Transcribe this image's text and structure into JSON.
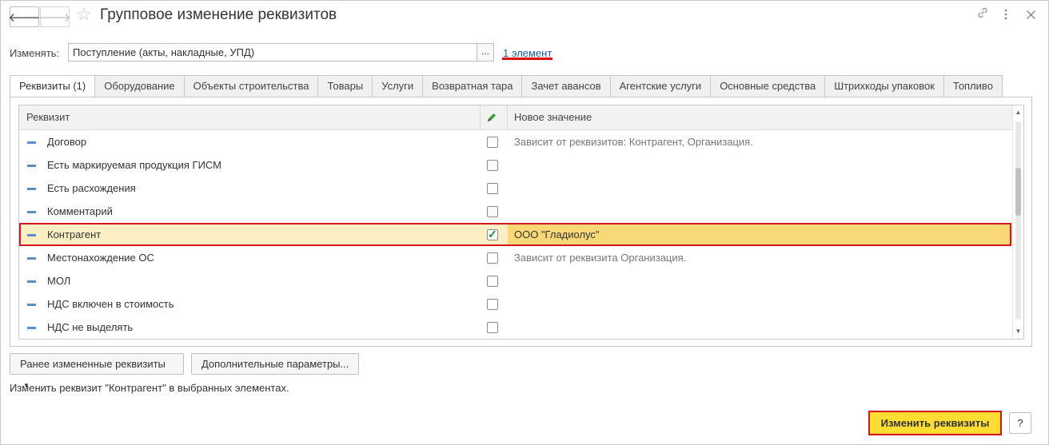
{
  "window": {
    "title": "Групповое изменение реквизитов",
    "back_icon": "arrow-left-icon",
    "forward_icon": "arrow-right-icon",
    "favorite_icon": "star-icon",
    "header_icons": [
      "link-icon",
      "more-icon",
      "close-icon"
    ]
  },
  "target": {
    "label": "Изменять:",
    "value": "Поступление (акты, накладные, УПД)",
    "select_button": "...",
    "count_link": "1 элемент"
  },
  "tabs": [
    {
      "label": "Реквизиты (1)",
      "active": true
    },
    {
      "label": "Оборудование",
      "active": false
    },
    {
      "label": "Объекты строительства",
      "active": false
    },
    {
      "label": "Товары",
      "active": false
    },
    {
      "label": "Услуги",
      "active": false
    },
    {
      "label": "Возвратная тара",
      "active": false
    },
    {
      "label": "Зачет авансов",
      "active": false
    },
    {
      "label": "Агентские услуги",
      "active": false
    },
    {
      "label": "Основные средства",
      "active": false
    },
    {
      "label": "Штрихкоды упаковок",
      "active": false
    },
    {
      "label": "Топливо",
      "active": false
    }
  ],
  "grid": {
    "columns": {
      "attribute": "Реквизит",
      "edit_icon": "pencil-icon",
      "new_value": "Новое значение"
    },
    "rows": [
      {
        "name": "Договор",
        "checked": false,
        "value": "Зависит от реквизитов: Контрагент, Организация."
      },
      {
        "name": "Есть маркируемая продукция ГИСМ",
        "checked": false,
        "value": ""
      },
      {
        "name": "Есть расхождения",
        "checked": false,
        "value": ""
      },
      {
        "name": "Комментарий",
        "checked": false,
        "value": ""
      },
      {
        "name": "Контрагент",
        "checked": true,
        "value": "ООО \"Гладиолус\"",
        "selected": true
      },
      {
        "name": "Местонахождение ОС",
        "checked": false,
        "value": "Зависит от реквизита Организация."
      },
      {
        "name": "МОЛ",
        "checked": false,
        "value": ""
      },
      {
        "name": "НДС включен в стоимость",
        "checked": false,
        "value": ""
      },
      {
        "name": "НДС не выделять",
        "checked": false,
        "value": ""
      }
    ]
  },
  "buttons": {
    "previous": "Ранее измененные реквизиты",
    "additional": "Дополнительные параметры...",
    "apply": "Изменить реквизиты",
    "help": "?"
  },
  "status_text": "Изменить реквизит \"Контрагент\" в выбранных элементах."
}
